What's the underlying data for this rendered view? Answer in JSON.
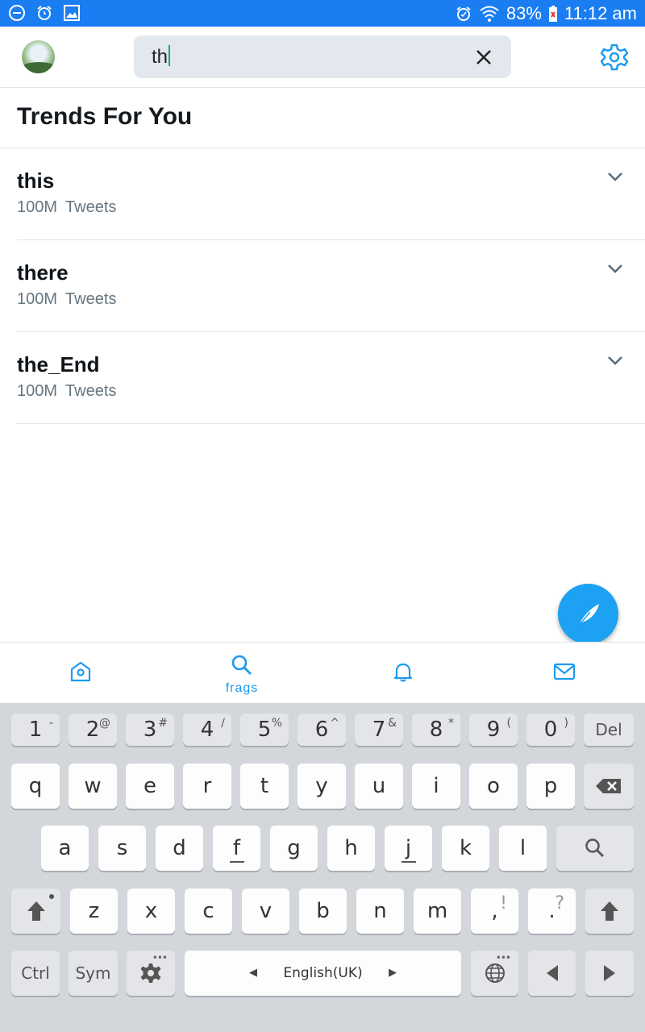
{
  "status_bar": {
    "battery": "83%",
    "time": "11:12 am",
    "icons": [
      "do-not-disturb-icon",
      "alarm-icon",
      "gallery-icon",
      "alarm-clock-icon",
      "wifi-icon",
      "battery-icon"
    ]
  },
  "search": {
    "query": "th"
  },
  "section_title": "Trends For You",
  "trends": [
    {
      "name": "this",
      "count": "100M",
      "unit": "Tweets"
    },
    {
      "name": "there",
      "count": "100M",
      "unit": "Tweets"
    },
    {
      "name": "the_End",
      "count": "100M",
      "unit": "Tweets"
    }
  ],
  "bottom_nav": {
    "search_label": "frags"
  },
  "keyboard": {
    "number_row": [
      {
        "main": "1",
        "sup": "-"
      },
      {
        "main": "2",
        "sup": "@"
      },
      {
        "main": "3",
        "sup": "#"
      },
      {
        "main": "4",
        "sup": "/"
      },
      {
        "main": "5",
        "sup": "%"
      },
      {
        "main": "6",
        "sup": "^"
      },
      {
        "main": "7",
        "sup": "&"
      },
      {
        "main": "8",
        "sup": "*"
      },
      {
        "main": "9",
        "sup": "("
      },
      {
        "main": "0",
        "sup": ")"
      }
    ],
    "del_label": "Del",
    "row1": [
      "q",
      "w",
      "e",
      "r",
      "t",
      "y",
      "u",
      "i",
      "o",
      "p"
    ],
    "row2": [
      "a",
      "s",
      "d",
      "f",
      "g",
      "h",
      "j",
      "k",
      "l"
    ],
    "row3": [
      "z",
      "x",
      "c",
      "v",
      "b",
      "n",
      "m"
    ],
    "comma_main": ",",
    "comma_sup": "!",
    "period_main": ".",
    "period_sup": "?",
    "ctrl_label": "Ctrl",
    "sym_label": "Sym",
    "language_label": "English(UK)"
  },
  "colors": {
    "accent": "#1da1f2",
    "status_bar": "#1a7ef2",
    "keyboard_bg": "#d3d6db"
  }
}
